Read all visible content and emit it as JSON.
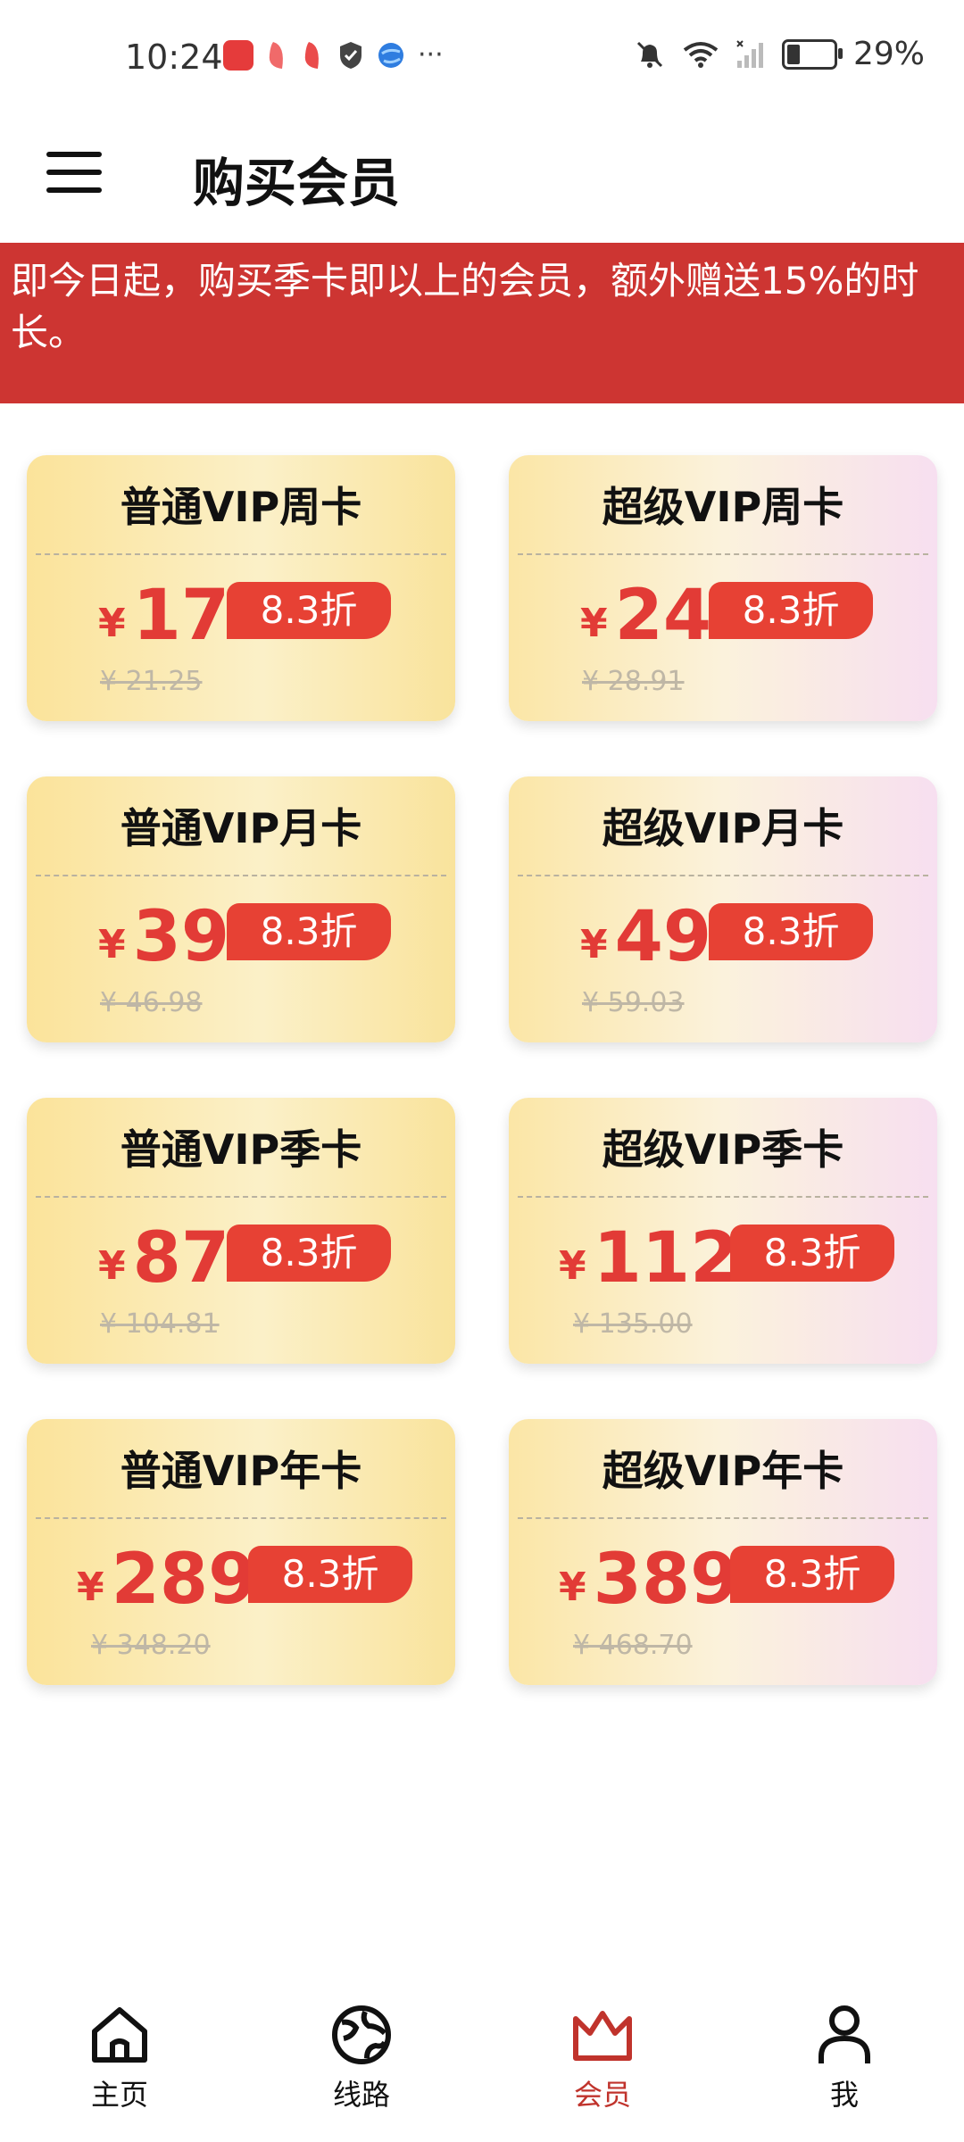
{
  "status_bar": {
    "time": "10:24",
    "left_icons": [
      "huawei-app-icon",
      "red-app-icon",
      "red-app-icon",
      "shield-icon",
      "browser-icon",
      "more-icon"
    ],
    "more": "···",
    "battery": "29%",
    "battery_level": 0.29
  },
  "header": {
    "title": "购买会员",
    "menu_icon": "hamburger-menu-icon"
  },
  "banner": {
    "text": "即今日起，购买季卡即以上的会员，额外赠送15%的时长。"
  },
  "currency_symbol": "¥",
  "cards": [
    {
      "title": "普通VIP周卡",
      "price": "17",
      "discount": "8.3折",
      "original": "¥ 21.25",
      "tier": "normal"
    },
    {
      "title": "超级VIP周卡",
      "price": "24",
      "discount": "8.3折",
      "original": "¥ 28.91",
      "tier": "super"
    },
    {
      "title": "普通VIP月卡",
      "price": "39",
      "discount": "8.3折",
      "original": "¥ 46.98",
      "tier": "normal"
    },
    {
      "title": "超级VIP月卡",
      "price": "49",
      "discount": "8.3折",
      "original": "¥ 59.03",
      "tier": "super"
    },
    {
      "title": "普通VIP季卡",
      "price": "87",
      "discount": "8.3折",
      "original": "¥ 104.81",
      "tier": "normal"
    },
    {
      "title": "超级VIP季卡",
      "price": "112",
      "discount": "8.3折",
      "original": "¥ 135.00",
      "tier": "super"
    },
    {
      "title": "普通VIP年卡",
      "price": "289",
      "discount": "8.3折",
      "original": "¥ 348.20",
      "tier": "normal"
    },
    {
      "title": "超级VIP年卡",
      "price": "389",
      "discount": "8.3折",
      "original": "¥ 468.70",
      "tier": "super"
    }
  ],
  "bottom_nav": [
    {
      "label": "主页",
      "icon": "home-icon",
      "active": false
    },
    {
      "label": "线路",
      "icon": "globe-icon",
      "active": false
    },
    {
      "label": "会员",
      "icon": "crown-icon",
      "active": true
    },
    {
      "label": "我",
      "icon": "person-icon",
      "active": false
    }
  ],
  "colors": {
    "accent": "#cd3532",
    "price_red": "#e23b36",
    "active_nav": "#c0332c",
    "card_gold": "#fbe39a",
    "card_pink": "#f7dff0"
  }
}
